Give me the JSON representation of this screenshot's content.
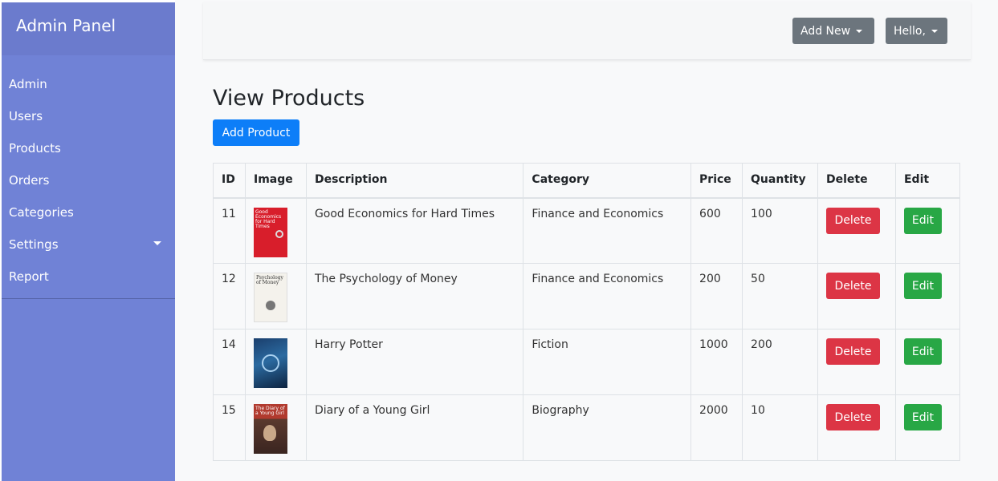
{
  "sidebar": {
    "brand": "Admin Panel",
    "items": [
      {
        "label": "Admin"
      },
      {
        "label": "Users"
      },
      {
        "label": "Products"
      },
      {
        "label": "Orders"
      },
      {
        "label": "Categories"
      },
      {
        "label": "Settings"
      },
      {
        "label": "Report"
      }
    ]
  },
  "topbar": {
    "add_new_label": "Add New",
    "user_label": "Hello,"
  },
  "page": {
    "title": "View Products",
    "add_product_label": "Add Product"
  },
  "table": {
    "headers": [
      "ID",
      "Image",
      "Description",
      "Category",
      "Price",
      "Quantity",
      "Delete",
      "Edit"
    ],
    "rows": [
      {
        "id": "11",
        "cover_text": "Good Economics for Hard Times",
        "description": "Good Economics for Hard Times",
        "category": "Finance and Economics",
        "price": "600",
        "quantity": "100",
        "delete_label": "Delete",
        "edit_label": "Edit"
      },
      {
        "id": "12",
        "cover_text": "Psychology of Money",
        "description": "The Psychology of Money",
        "category": "Finance and Economics",
        "price": "200",
        "quantity": "50",
        "delete_label": "Delete",
        "edit_label": "Edit"
      },
      {
        "id": "14",
        "cover_text": "",
        "description": "Harry Potter",
        "category": "Fiction",
        "price": "1000",
        "quantity": "200",
        "delete_label": "Delete",
        "edit_label": "Edit"
      },
      {
        "id": "15",
        "cover_text": "The Diary of a Young Girl",
        "description": "Diary of a Young Girl",
        "category": "Biography",
        "price": "2000",
        "quantity": "10",
        "delete_label": "Delete",
        "edit_label": "Edit"
      }
    ]
  },
  "colors": {
    "sidebar": "#7082d6",
    "primary": "#0d7ef8",
    "danger": "#dc3545",
    "success": "#28a745",
    "secondary": "#6c757d"
  },
  "icons": {
    "dropdown": "caret-down-icon"
  }
}
